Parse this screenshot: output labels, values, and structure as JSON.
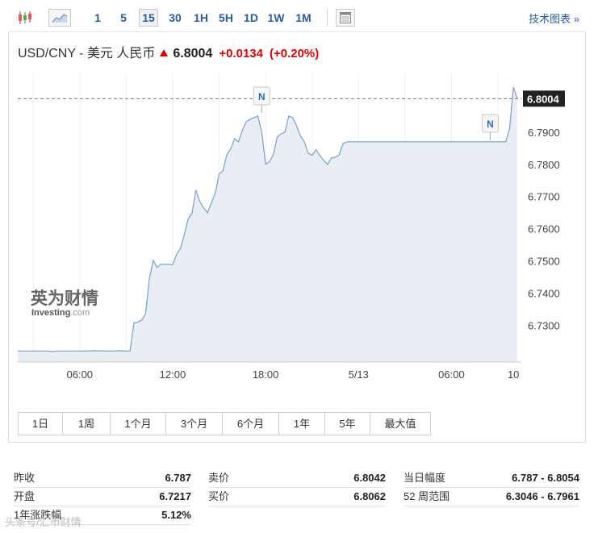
{
  "toolbar": {
    "timeframes": [
      "1",
      "5",
      "15",
      "30",
      "1H",
      "5H",
      "1D",
      "1W",
      "1M"
    ],
    "active_timeframe": "15",
    "tech_chart_label": "技术图表 »"
  },
  "header": {
    "pair": "USD/CNY - 美元 人民币",
    "price": "6.8004",
    "change": "+0.0134",
    "change_pct": "(+0.20%)",
    "change_color": "#e00000"
  },
  "watermark_logo": {
    "line1": "英为财情",
    "line2": "Investing",
    "line2_suffix": ".com"
  },
  "chart_data": {
    "type": "area",
    "title": "",
    "xlabel": "",
    "ylabel": "",
    "x_ticks": [
      "06:00",
      "12:00",
      "18:00",
      "5/13",
      "06:00",
      "10"
    ],
    "y_ticks": [
      "6.7300",
      "6.7400",
      "6.7500",
      "6.7600",
      "6.7700",
      "6.7800",
      "6.7900"
    ],
    "ylim": [
      6.7186,
      6.8085
    ],
    "current_price_label": "6.8004",
    "current_price": 6.8004,
    "news_marker_label": "N",
    "news_markers": [
      {
        "time": "17:45"
      },
      {
        "time": "5/13 08:30"
      }
    ],
    "line_color": "#7fa7cf",
    "fill_color": "#e8eef4",
    "series": [
      {
        "values": [
          [
            "02:00",
            6.722
          ],
          [
            "03:00",
            6.722
          ],
          [
            "04:00",
            6.722
          ],
          [
            "04:15",
            6.7218
          ],
          [
            "04:30",
            6.722
          ],
          [
            "05:00",
            6.722
          ],
          [
            "06:00",
            6.722
          ],
          [
            "07:00",
            6.7221
          ],
          [
            "08:00",
            6.722
          ],
          [
            "08:30",
            6.7221
          ],
          [
            "09:00",
            6.722
          ],
          [
            "09:15",
            6.7221
          ],
          [
            "09:30",
            6.7308
          ],
          [
            "09:45",
            6.731
          ],
          [
            "10:00",
            6.7316
          ],
          [
            "10:15",
            6.7335
          ],
          [
            "10:30",
            6.7445
          ],
          [
            "10:45",
            6.7502
          ],
          [
            "11:00",
            6.748
          ],
          [
            "11:15",
            6.749
          ],
          [
            "11:30",
            6.749
          ],
          [
            "11:45",
            6.749
          ],
          [
            "12:00",
            6.7488
          ],
          [
            "12:15",
            6.752
          ],
          [
            "12:30",
            6.7538
          ],
          [
            "12:45",
            6.758
          ],
          [
            "13:00",
            6.763
          ],
          [
            "13:15",
            6.7648
          ],
          [
            "13:30",
            6.772
          ],
          [
            "13:45",
            6.7685
          ],
          [
            "14:00",
            6.7665
          ],
          [
            "14:15",
            6.765
          ],
          [
            "14:30",
            6.768
          ],
          [
            "14:45",
            6.771
          ],
          [
            "15:00",
            6.777
          ],
          [
            "15:15",
            6.778
          ],
          [
            "15:30",
            6.783
          ],
          [
            "15:45",
            6.7848
          ],
          [
            "16:00",
            6.788
          ],
          [
            "16:15",
            6.787
          ],
          [
            "16:30",
            6.7905
          ],
          [
            "16:45",
            6.7932
          ],
          [
            "17:00",
            6.794
          ],
          [
            "17:30",
            6.795
          ],
          [
            "17:45",
            6.79
          ],
          [
            "18:00",
            6.78
          ],
          [
            "18:15",
            6.7808
          ],
          [
            "18:30",
            6.783
          ],
          [
            "18:45",
            6.7885
          ],
          [
            "19:00",
            6.7895
          ],
          [
            "19:15",
            6.79
          ],
          [
            "19:30",
            6.795
          ],
          [
            "19:45",
            6.7945
          ],
          [
            "20:00",
            6.792
          ],
          [
            "20:15",
            6.7888
          ],
          [
            "20:30",
            6.787
          ],
          [
            "20:45",
            6.7835
          ],
          [
            "21:00",
            6.7828
          ],
          [
            "21:15",
            6.7845
          ],
          [
            "21:30",
            6.7828
          ],
          [
            "21:45",
            6.7812
          ],
          [
            "22:00",
            6.78
          ],
          [
            "22:15",
            6.782
          ],
          [
            "22:30",
            6.7822
          ],
          [
            "22:45",
            6.783
          ],
          [
            "23:00",
            6.7865
          ],
          [
            "23:15",
            6.787
          ],
          [
            "23:30",
            6.787
          ],
          [
            "5/13 00:00",
            6.787
          ],
          [
            "5/13 02:00",
            6.787
          ],
          [
            "5/13 04:00",
            6.787
          ],
          [
            "5/13 06:00",
            6.787
          ],
          [
            "5/13 08:00",
            6.787
          ],
          [
            "5/13 09:00",
            6.787
          ],
          [
            "5/13 09:30",
            6.787
          ],
          [
            "5/13 09:45",
            6.791
          ],
          [
            "5/13 10:00",
            6.804
          ],
          [
            "5/13 10:15",
            6.8004
          ]
        ]
      }
    ]
  },
  "ranges": [
    "1日",
    "1周",
    "1个月",
    "3个月",
    "6个月",
    "1年",
    "5年",
    "最大值"
  ],
  "stats": {
    "prev_close_label": "昨收",
    "prev_close": "6.787",
    "open_label": "开盘",
    "open": "6.7217",
    "year_change_label": "1年涨跌幅",
    "year_change": "5.12%",
    "bid_label": "卖价",
    "bid": "6.8042",
    "ask_label": "买价",
    "ask": "6.8062",
    "day_range_label": "当日幅度",
    "day_range": "6.787 - 6.8054",
    "week52_label": "52 周范围",
    "week52": "6.3046 - 6.7961"
  },
  "watermark": "头条号/汇市财情"
}
